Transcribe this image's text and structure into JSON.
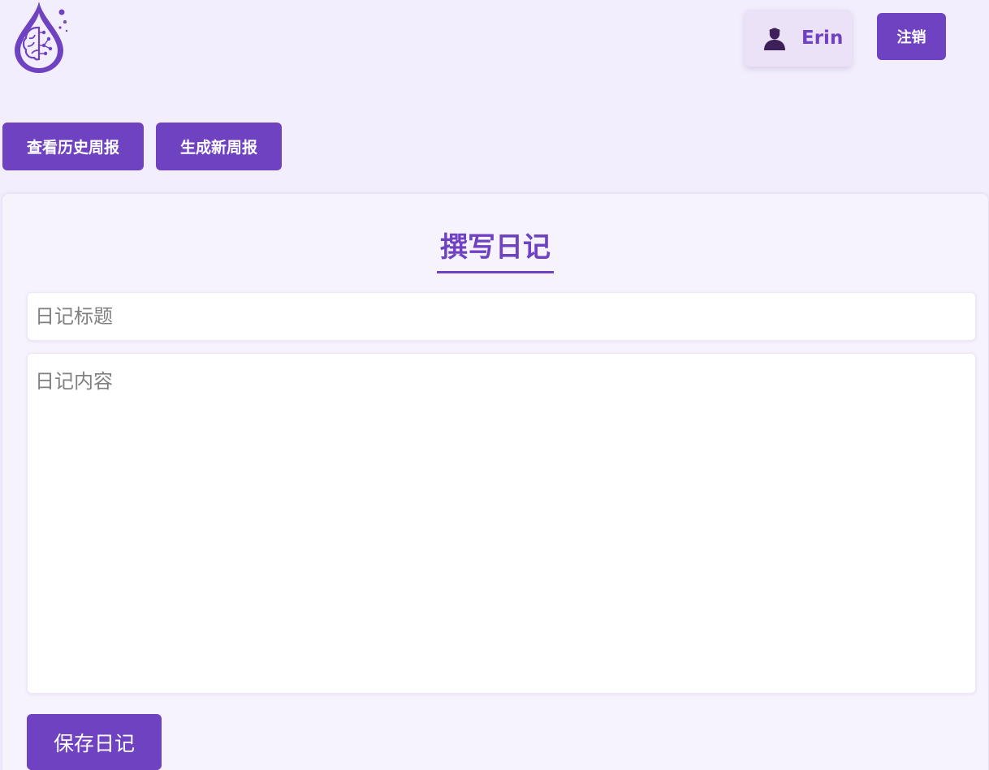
{
  "header": {
    "logo_icon": "brain-drop-logo-icon",
    "user": {
      "name": "Erin",
      "icon": "user-avatar-icon"
    },
    "logout_label": "注销"
  },
  "nav": {
    "history_label": "查看历史周报",
    "generate_label": "生成新周报"
  },
  "editor": {
    "heading": "撰写日记",
    "title_placeholder": "日记标题",
    "title_value": "",
    "content_placeholder": "日记内容",
    "content_value": "",
    "save_label": "保存日记"
  },
  "colors": {
    "accent": "#6f42c1",
    "page_background": "#f3eefd",
    "card_background": "#f7f3fd",
    "user_chip_background": "#ebe2f8"
  }
}
